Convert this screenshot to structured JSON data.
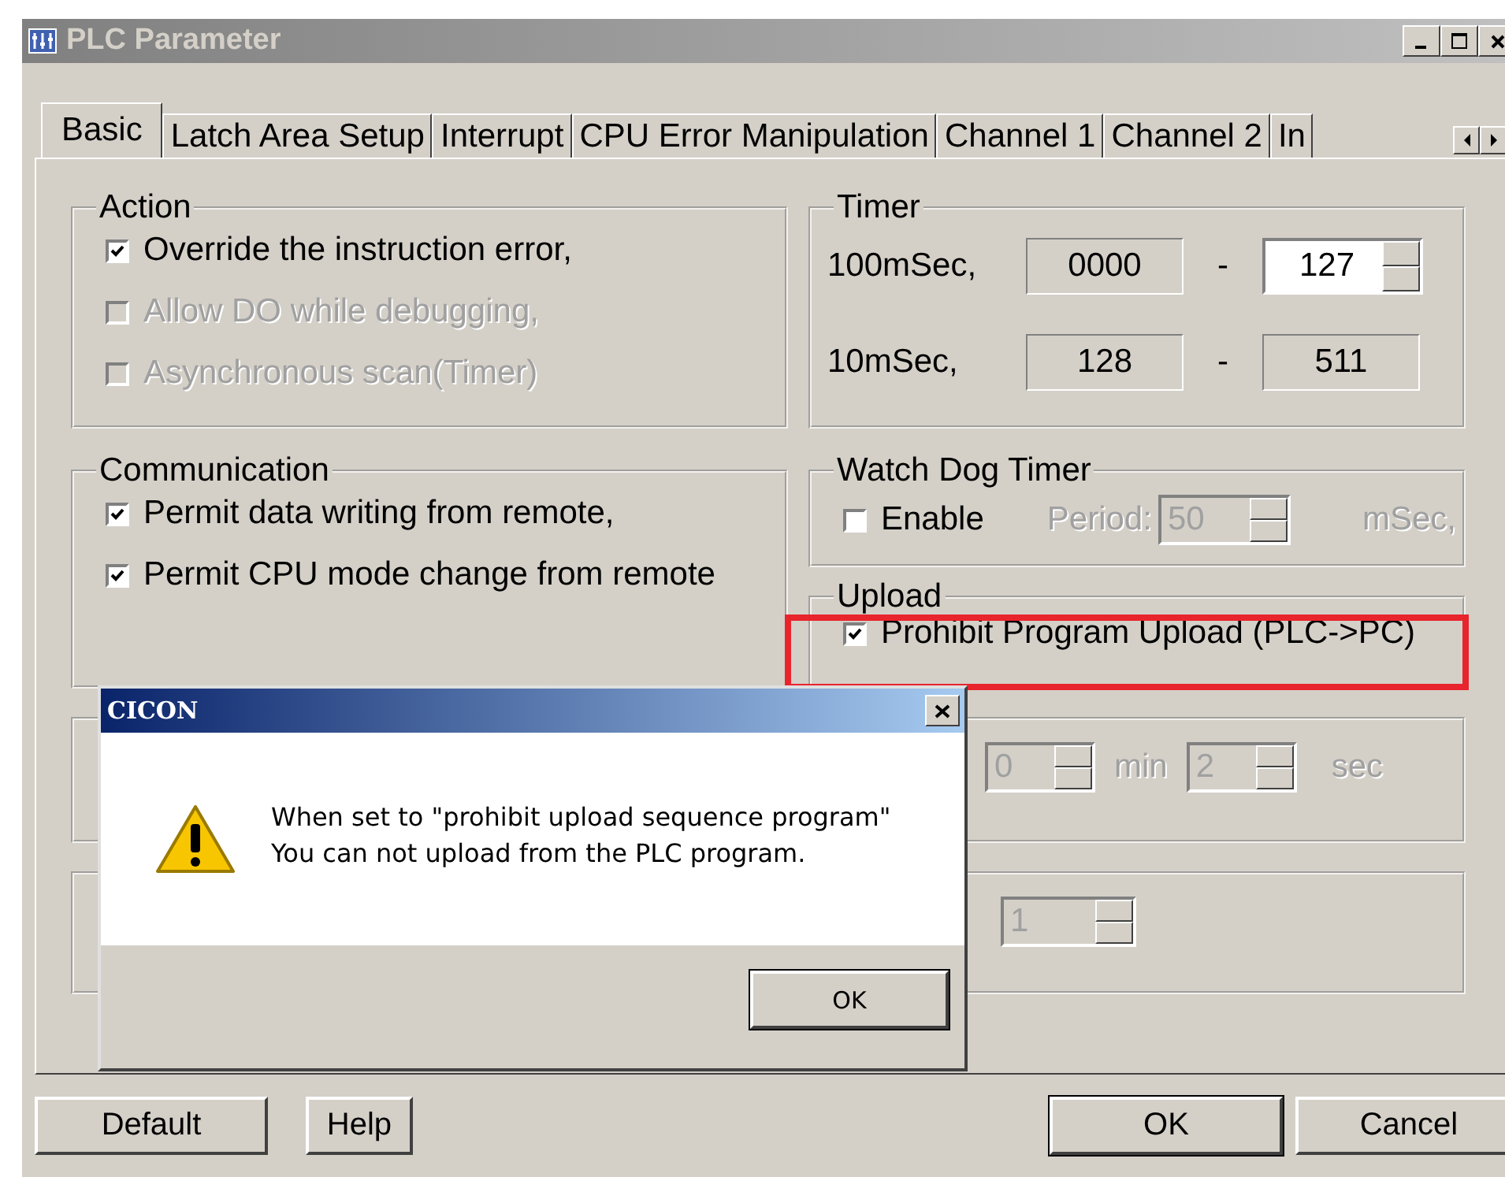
{
  "window": {
    "title": "PLC Parameter"
  },
  "tabs": [
    {
      "label": "Basic",
      "selected": true
    },
    {
      "label": "Latch Area Setup",
      "selected": false
    },
    {
      "label": "Interrupt",
      "selected": false
    },
    {
      "label": "CPU Error Manipulation",
      "selected": false
    },
    {
      "label": "Channel 1",
      "selected": false
    },
    {
      "label": "Channel 2",
      "selected": false
    },
    {
      "label": "In",
      "selected": false
    }
  ],
  "action": {
    "title": "Action",
    "items": [
      {
        "label": "Override the instruction error,",
        "checked": true,
        "disabled": false
      },
      {
        "label": "Allow DO while debugging,",
        "checked": false,
        "disabled": true
      },
      {
        "label": "Asynchronous scan(Timer)",
        "checked": false,
        "disabled": true
      }
    ]
  },
  "timer": {
    "title": "Timer",
    "rows": [
      {
        "label": "100mSec,",
        "from": "0000",
        "dash": "-",
        "to": "127",
        "editable": true
      },
      {
        "label": "10mSec,",
        "from": "128",
        "dash": "-",
        "to": "511",
        "editable": false
      }
    ]
  },
  "communication": {
    "title": "Communication",
    "items": [
      {
        "label": "Permit data writing from remote,",
        "checked": true,
        "disabled": false
      },
      {
        "label": "Permit CPU mode change from remote",
        "checked": true,
        "disabled": false
      }
    ]
  },
  "watch_dog": {
    "title": "Watch Dog Timer",
    "enable": {
      "label": "Enable",
      "checked": false
    },
    "period_label": "Period:",
    "period": "50",
    "unit": "mSec,"
  },
  "upload": {
    "title": "Upload",
    "highlighted": true,
    "item": {
      "label": "Prohibit Program Upload (PLC->PC)",
      "checked": true
    }
  },
  "lower_group_1": {
    "minutes": "0",
    "min_label": "min",
    "seconds": "2",
    "sec_label": "sec"
  },
  "lower_group_2": {
    "value": "1"
  },
  "buttons_left": [
    "Default",
    "Help"
  ],
  "buttons_right": [
    {
      "label": "OK",
      "default": true
    },
    {
      "label": "Cancel",
      "default": false
    }
  ],
  "alert": {
    "title": "CICON",
    "lines": [
      "When set to \"prohibit upload sequence program\"",
      "You can not upload from the PLC program."
    ],
    "button": "OK"
  }
}
